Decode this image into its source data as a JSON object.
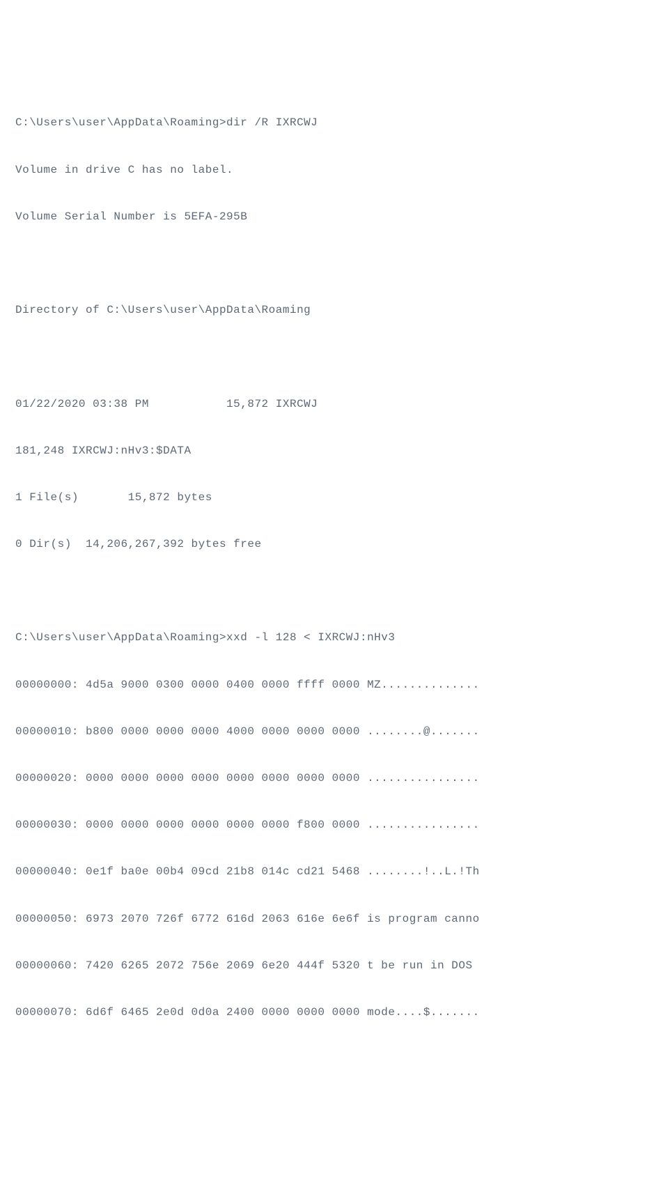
{
  "terminal": {
    "lines": [
      "C:\\Users\\user\\AppData\\Roaming>dir /R IXRCWJ",
      "Volume in drive C has no label.",
      "Volume Serial Number is 5EFA-295B",
      "",
      "",
      "Directory of C:\\Users\\user\\AppData\\Roaming",
      "",
      "",
      "01/22/2020 03:38 PM           15,872 IXRCWJ",
      "181,248 IXRCWJ:nHv3:$DATA",
      "1 File(s)       15,872 bytes",
      "0 Dir(s)  14,206,267,392 bytes free",
      "",
      "",
      "C:\\Users\\user\\AppData\\Roaming>xxd -l 128 < IXRCWJ:nHv3",
      "00000000: 4d5a 9000 0300 0000 0400 0000 ffff 0000 MZ..............",
      "00000010: b800 0000 0000 0000 4000 0000 0000 0000 ........@.......",
      "00000020: 0000 0000 0000 0000 0000 0000 0000 0000 ................",
      "00000030: 0000 0000 0000 0000 0000 0000 f800 0000 ................",
      "00000040: 0e1f ba0e 00b4 09cd 21b8 014c cd21 5468 ........!..L.!Th",
      "00000050: 6973 2070 726f 6772 616d 2063 616e 6e6f is program canno",
      "00000060: 7420 6265 2072 756e 2069 6e20 444f 5320 t be run in DOS",
      "00000070: 6d6f 6465 2e0d 0d0a 2400 0000 0000 0000 mode....$......."
    ]
  }
}
